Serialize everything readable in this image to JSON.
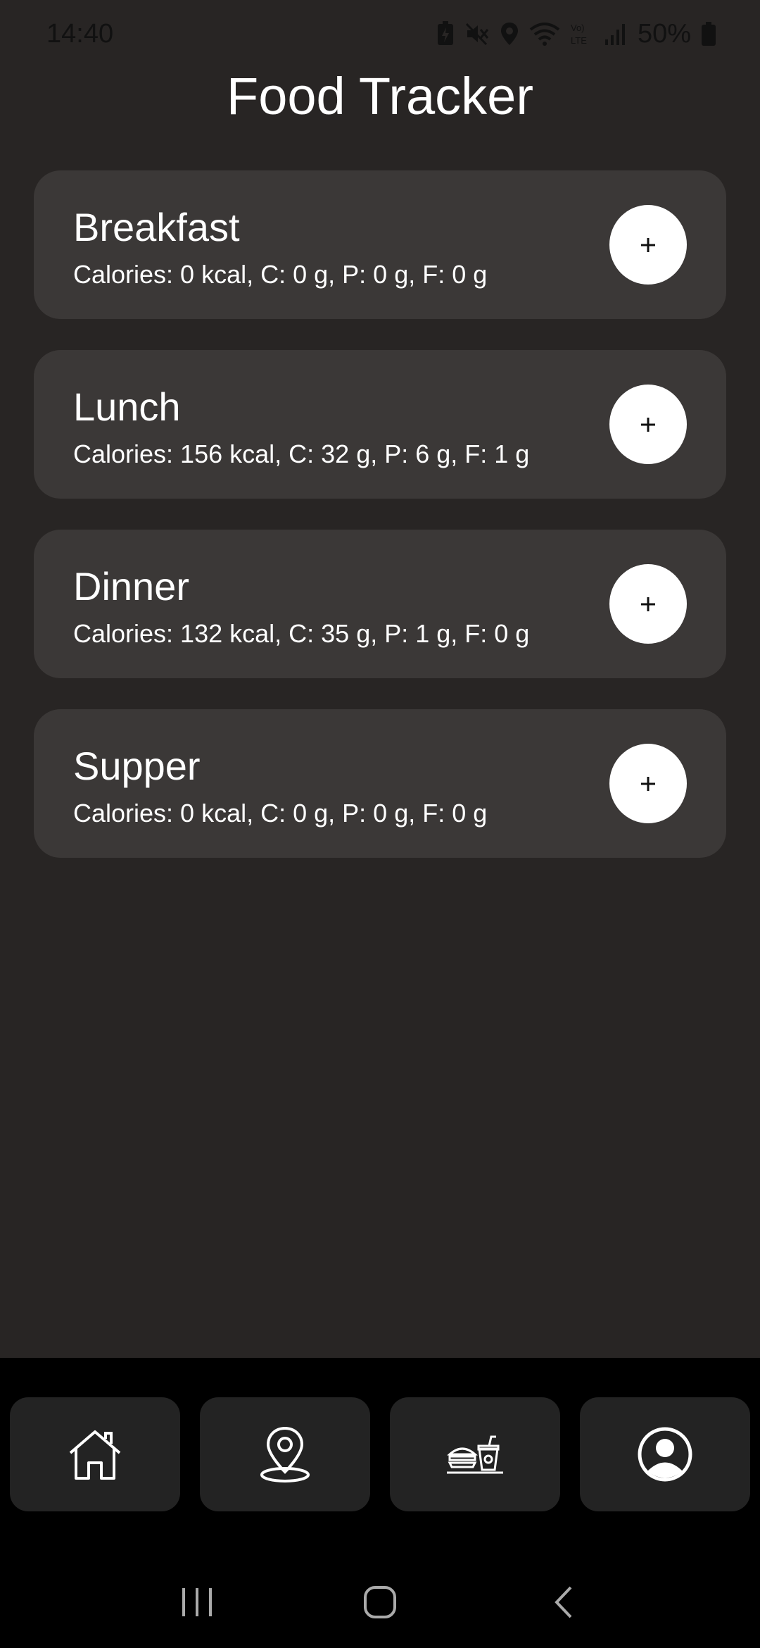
{
  "status_bar": {
    "time": "14:40",
    "battery_percent": "50%",
    "icons": [
      "battery-saver-icon",
      "mute-icon",
      "location-icon",
      "wifi-icon",
      "volte-icon",
      "signal-icon",
      "battery-icon"
    ]
  },
  "page": {
    "title": "Food Tracker"
  },
  "meals": [
    {
      "name": "Breakfast",
      "summary": "Calories: 0 kcal, C: 0 g, P: 0 g, F: 0 g",
      "add_label": "+"
    },
    {
      "name": "Lunch",
      "summary": "Calories: 156 kcal, C: 32 g, P: 6 g, F: 1 g",
      "add_label": "+"
    },
    {
      "name": "Dinner",
      "summary": "Calories: 132 kcal, C: 35 g, P: 1 g, F: 0 g",
      "add_label": "+"
    },
    {
      "name": "Supper",
      "summary": "Calories: 0 kcal, C: 0 g, P: 0 g, F: 0 g",
      "add_label": "+"
    }
  ],
  "bottom_nav": {
    "items": [
      "home-icon",
      "location-pin-icon",
      "food-icon",
      "profile-icon"
    ]
  },
  "system_nav": {
    "items": [
      "recent-apps-icon",
      "home-circle-icon",
      "back-icon"
    ]
  },
  "colors": {
    "background": "#282524",
    "card": "#3b3837",
    "nav_bar": "#000000",
    "nav_item": "#232323",
    "text": "#ffffff"
  }
}
